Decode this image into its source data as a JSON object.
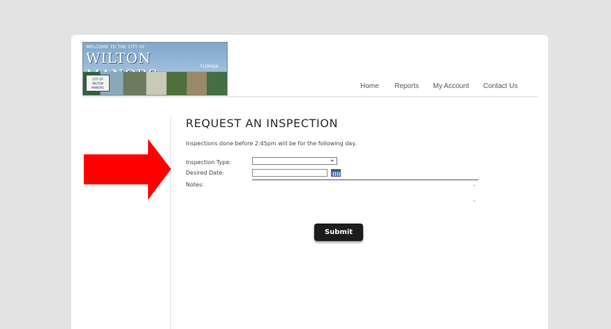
{
  "logo": {
    "welcome": "WELCOME TO THE CITY OF",
    "city": "WILTON MANORS",
    "state": "FLORIDA",
    "seal_text": "CITY OF WILTON MANORS"
  },
  "nav": {
    "items": [
      {
        "label": "Home"
      },
      {
        "label": "Reports"
      },
      {
        "label": "My Account"
      },
      {
        "label": "Contact Us"
      }
    ]
  },
  "page": {
    "title": "REQUEST AN INSPECTION",
    "notice": "Inspections done before 2:45pm will be for the following day."
  },
  "form": {
    "inspection_type_label": "Inspection Type:",
    "inspection_type_value": "",
    "desired_date_label": "Desired Date:",
    "desired_date_value": "",
    "notes_label": "Notes:",
    "notes_value": "",
    "submit_label": "Submit"
  },
  "colors": {
    "arrow": "#ff0000",
    "submit_bg": "#1c1c1c",
    "page_bg": "#e3e3e3"
  }
}
